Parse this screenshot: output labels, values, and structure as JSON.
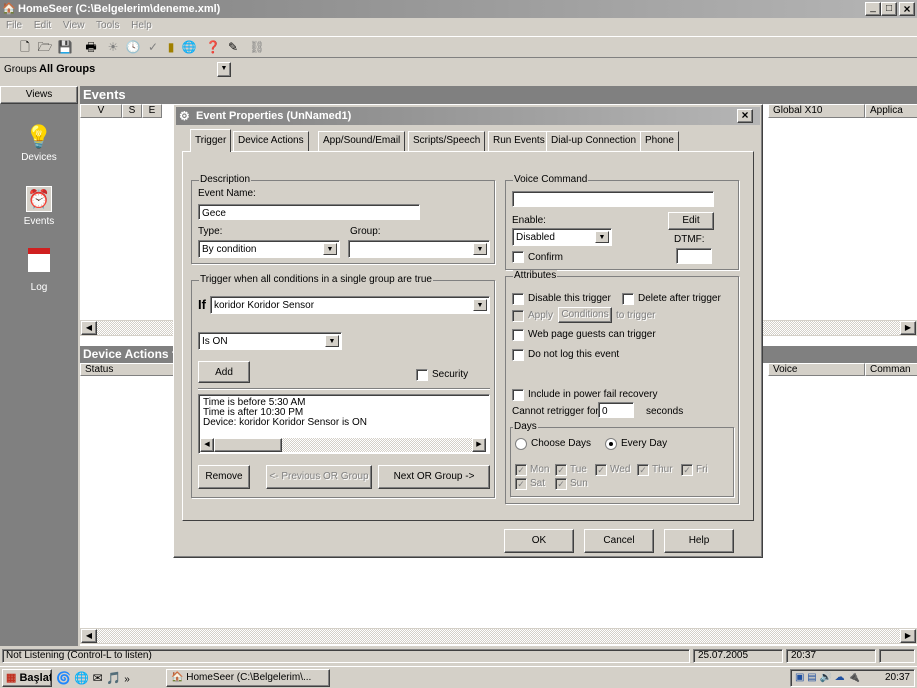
{
  "app": {
    "title": "HomeSeer (C:\\Belgelerim\\deneme.xml)",
    "menu": [
      "File",
      "Edit",
      "View",
      "Tools",
      "Help"
    ],
    "window_buttons": [
      "_",
      "□",
      "×"
    ],
    "toolbar_icons": [
      "new-icon",
      "open-icon",
      "save-icon",
      "print-icon",
      "tools-icon",
      "clock-icon",
      "check-icon",
      "schedule-icon",
      "globe-icon",
      "help-icon",
      "wand-icon",
      "link-icon"
    ],
    "groups_label": "Groups",
    "groups_value": "All Groups"
  },
  "sidebar": {
    "header": "Views",
    "items": [
      {
        "label": "Devices",
        "icon": "lightbulb-icon"
      },
      {
        "label": "Events",
        "icon": "alarm-clock-icon"
      },
      {
        "label": "Log",
        "icon": "log-book-icon"
      }
    ]
  },
  "events_panel": {
    "title": "Events",
    "columns": [
      "V",
      "S",
      "E"
    ],
    "right_columns": [
      "Global X10",
      "Applica"
    ]
  },
  "device_actions_panel": {
    "title": "Device Actions f",
    "columns": [
      "Status"
    ],
    "right_columns": [
      "Voice",
      "Comman"
    ]
  },
  "status_bar": {
    "message": "Not Listening (Control-L to listen)",
    "date": "25.07.2005",
    "time": "20:37"
  },
  "taskbar": {
    "start_label": "Başlat",
    "task_label": "HomeSeer (C:\\Belgelerim\\...",
    "chevron": "»",
    "clock": "20:37"
  },
  "dialog": {
    "title": "Event Properties (UnNamed1)",
    "tabs": [
      "Trigger",
      "Device Actions",
      "App/Sound/Email",
      "Scripts/Speech",
      "Run Events",
      "Dial-up Connection",
      "Phone"
    ],
    "description": {
      "legend": "Description",
      "event_name_label": "Event Name:",
      "event_name_value": "Gece",
      "type_label": "Type:",
      "type_value": "By condition",
      "group_label": "Group:",
      "group_value": ""
    },
    "trigger_group": {
      "legend": "Trigger when all conditions in a single group are true",
      "if_label": "If",
      "device_value": "koridor Koridor Sensor",
      "condition_value": "Is ON",
      "add_label": "Add",
      "security_label": "Security",
      "conditions": [
        "Time is before 5:30 AM",
        "Time is after 10:30 PM",
        "Device: koridor Koridor Sensor is ON"
      ],
      "remove_label": "Remove",
      "prev_label": "<- Previous OR Group",
      "next_label": "Next OR Group ->"
    },
    "voice": {
      "legend": "Voice Command",
      "command_value": "",
      "enable_label": "Enable:",
      "enable_value": "Disabled",
      "edit_label": "Edit",
      "dtmf_label": "DTMF:",
      "dtmf_value": "",
      "confirm_label": "Confirm"
    },
    "attributes": {
      "legend": "Attributes",
      "disable_label": "Disable this trigger",
      "delete_label": "Delete after trigger",
      "apply_label": "Apply",
      "conditions_btn": "Conditions",
      "to_trigger_label": "to trigger",
      "web_label": "Web page guests can trigger",
      "nolog_label": "Do not log this event",
      "power_label": "Include in power fail recovery",
      "retrigger_label": "Cannot retrigger for",
      "retrigger_value": "0",
      "seconds_label": "seconds"
    },
    "days": {
      "legend": "Days",
      "choose_label": "Choose Days",
      "every_label": "Every Day",
      "selected": "Every Day",
      "day_names": [
        "Mon",
        "Tue",
        "Wed",
        "Thur",
        "Fri",
        "Sat",
        "Sun"
      ]
    },
    "buttons": {
      "ok": "OK",
      "cancel": "Cancel",
      "help": "Help"
    }
  }
}
